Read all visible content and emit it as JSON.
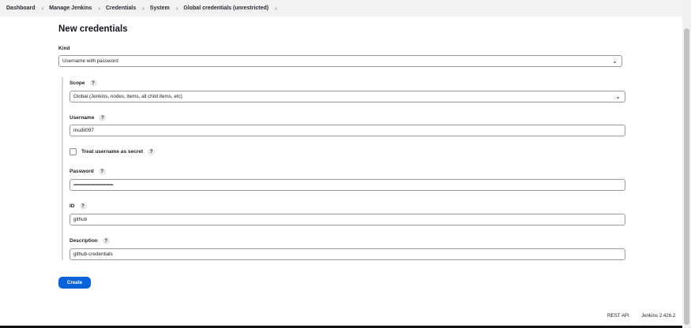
{
  "breadcrumb": [
    {
      "label": "Dashboard"
    },
    {
      "label": "Manage Jenkins"
    },
    {
      "label": "Credentials"
    },
    {
      "label": "System"
    },
    {
      "label": "Global credentials (unrestricted)"
    }
  ],
  "page": {
    "title": "New credentials"
  },
  "form": {
    "kind": {
      "label": "Kind",
      "value": "Username with password"
    },
    "scope": {
      "label": "Scope",
      "help": "?",
      "value": "Global (Jenkins, nodes, items, all child items, etc)"
    },
    "username": {
      "label": "Username",
      "help": "?",
      "value": "mudit097"
    },
    "treat_secret": {
      "label": "Treat username as secret",
      "help": "?",
      "checked": false
    },
    "password": {
      "label": "Password",
      "help": "?",
      "value": "••••••••••••••••••••••••••••••••••••••••"
    },
    "id": {
      "label": "ID",
      "help": "?",
      "value": "github"
    },
    "description": {
      "label": "Description",
      "help": "?",
      "value": "github-credentials"
    }
  },
  "actions": {
    "create_label": "Create"
  },
  "footer": {
    "rest_api": "REST API",
    "version": "Jenkins 2.426.2"
  },
  "colors": {
    "primary": "#0a62d8",
    "breadcrumb_bg": "#f2f2f3"
  }
}
